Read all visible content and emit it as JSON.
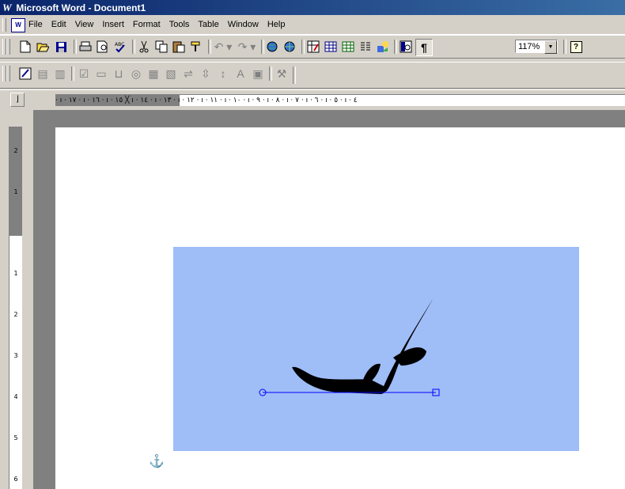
{
  "window": {
    "title": "Microsoft Word - Document1",
    "logo": "W"
  },
  "menu": [
    "File",
    "Edit",
    "View",
    "Insert",
    "Format",
    "Tools",
    "Table",
    "Window",
    "Help"
  ],
  "toolbar": {
    "zoom": "117%",
    "pilcrow": "¶",
    "help": "?"
  },
  "ruler": {
    "horizontal": "· ı · ١٧ · ı · ١٦ · ı · ١٥ ╳ ı · ١٤ · ı · ١٣ · ı · ١٢ · ı · ١١ · ı · ١٠ · ı · ٩ · ı · ٨ · ı · ٧ · ı · ٦ · ı · ٥ · ı · ٤",
    "vertical_top": [
      "2",
      "1"
    ],
    "vertical_bottom": [
      "1",
      "2",
      "3",
      "4",
      "5",
      "6"
    ]
  },
  "document": {
    "calligraphy_text": "كلك",
    "shape_fill": "#9fbdf7",
    "connector_color": "#0000ff"
  },
  "icons": [
    "new-icon",
    "open-icon",
    "save-icon",
    "print-icon",
    "print-preview-icon",
    "spelling-icon",
    "cut-icon",
    "copy-icon",
    "paste-icon",
    "format-painter-icon",
    "undo-icon",
    "redo-icon",
    "hyperlink-icon",
    "web-toolbar-icon",
    "tables-borders-icon",
    "insert-table-icon",
    "insert-excel-icon",
    "columns-icon",
    "drawing-icon",
    "document-map-icon",
    "show-hide-icon",
    "help-icon"
  ]
}
